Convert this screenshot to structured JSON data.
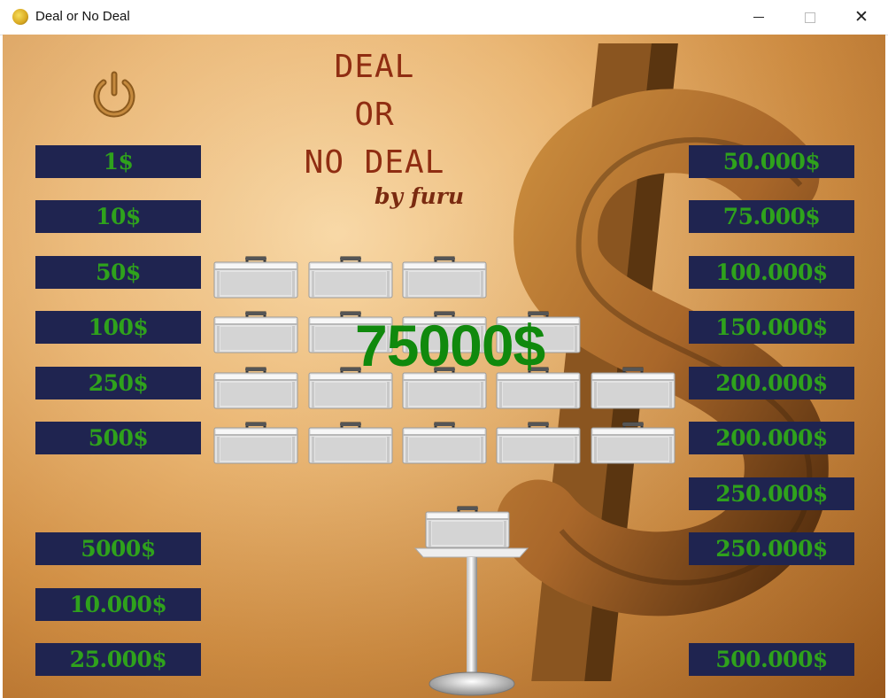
{
  "window": {
    "title": "Deal or No Deal",
    "buttons": [
      "minimize",
      "maximize",
      "close"
    ]
  },
  "header": {
    "title_lines": [
      "DEAL",
      "OR",
      "NO DEAL"
    ],
    "byline": "by furu"
  },
  "left_values": [
    "1$",
    "10$",
    "50$",
    "100$",
    "250$",
    "500$",
    "5000$",
    "10.000$",
    "25.000$"
  ],
  "right_values": [
    "50.000$",
    "75.000$",
    "100.000$",
    "150.000$",
    "200.000$",
    "200.000$",
    "250.000$",
    "250.000$",
    "500.000$"
  ],
  "offer": "75000$",
  "cases": {
    "rows": [
      3,
      4,
      5,
      5
    ],
    "player_case": 1
  },
  "colors": {
    "label_bg": "#1f2450",
    "label_text": "#2fa21c",
    "offer_text": "#10890d",
    "title_text": "#8f2d12"
  },
  "icons": [
    "power-icon",
    "briefcase-icon",
    "dollar-sign-icon"
  ]
}
